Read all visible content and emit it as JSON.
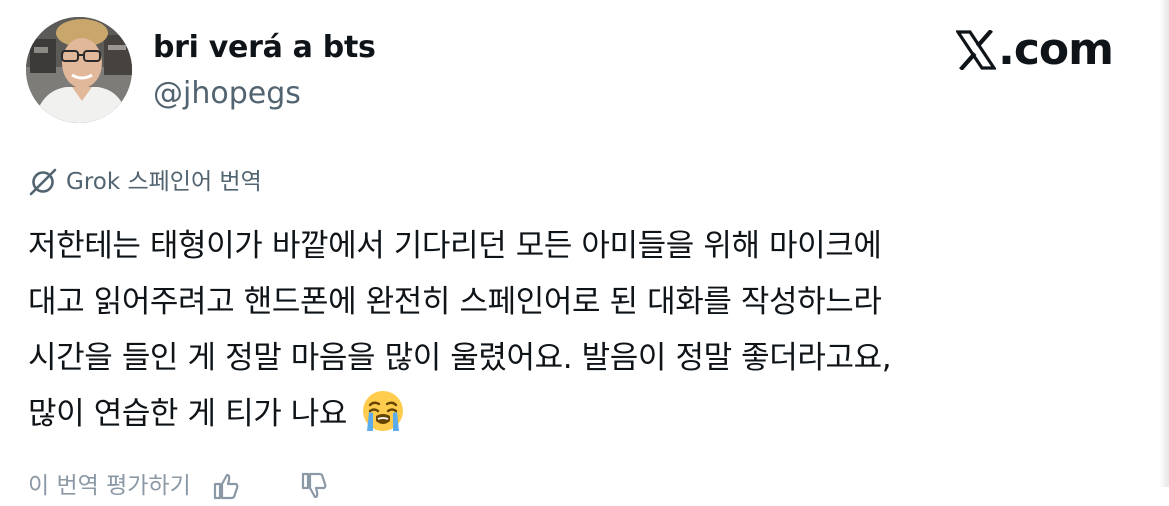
{
  "post": {
    "author_name": "bri verá a bts",
    "author_handle": "@jhopegs",
    "brand": ".com",
    "translation_label": "Grok 스페인어 번역",
    "body_lines": [
      "저한테는 태형이가 바깥에서 기다리던 모든 아미들을 위해 마이크에",
      "대고 읽어주려고 핸드폰에 완전히 스페인어로 된 대화를 작성하느라",
      "시간을 들인 게 정말 마음을 많이 울렸어요. 발음이 정말 좋더라고요,",
      "많이 연습한 게 티가 나요"
    ],
    "emoji": "loudly-crying-face",
    "footer_label": "이 번역 평가하기",
    "footer_icons": [
      "thumbs-up-icon",
      "thumbs-down-icon"
    ]
  },
  "colors": {
    "text_primary": "#0f1419",
    "text_secondary": "#536471",
    "text_muted": "#8b98a5",
    "background": "#ffffff"
  }
}
